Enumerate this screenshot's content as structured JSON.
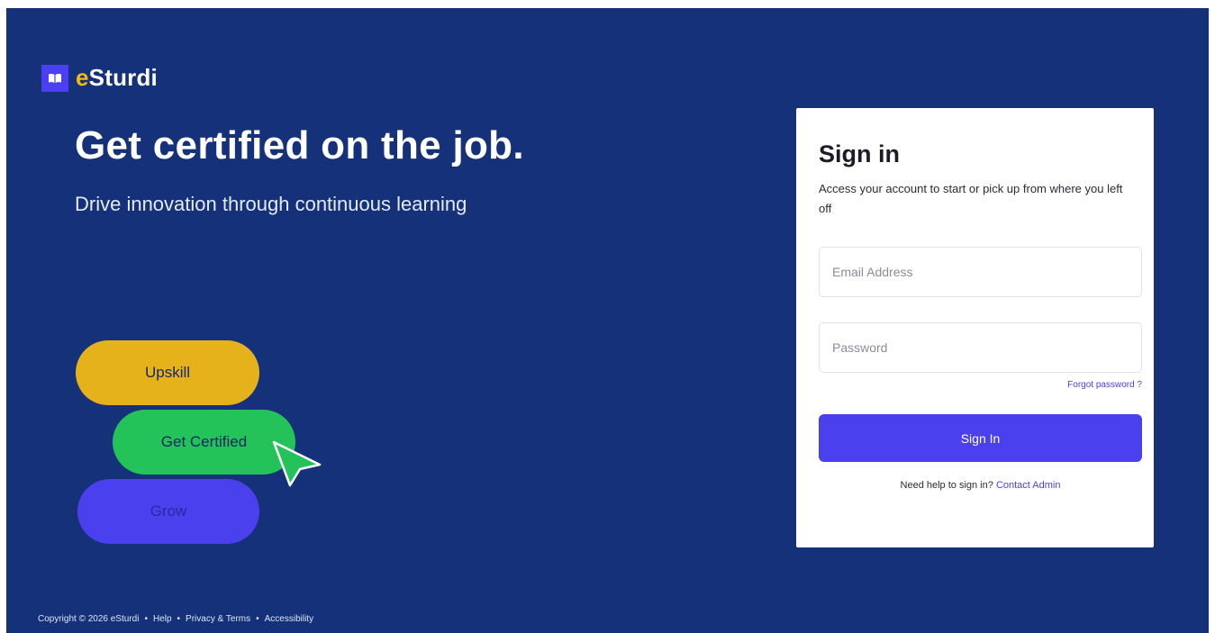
{
  "brand": {
    "name_e": "e",
    "name_rest": "Sturdi",
    "logo_icon": "open-book-icon",
    "colors": {
      "background": "#14317a",
      "accent": "#4b40ee",
      "yellow": "#e6b21c",
      "green": "#23c35a"
    }
  },
  "hero": {
    "title": "Get certified on the job.",
    "subtitle": "Drive innovation through continuous learning"
  },
  "pills": {
    "upskill": "Upskill",
    "certified": "Get Certified",
    "grow": "Grow"
  },
  "signin": {
    "title": "Sign in",
    "description": "Access your account to start or pick up from where you left off",
    "email_placeholder": "Email Address",
    "password_placeholder": "Password",
    "forgot_label": "Forgot password ?",
    "button_label": "Sign In",
    "help_text": "Need help to sign in?",
    "help_link": "Contact Admin"
  },
  "footer": {
    "copyright": "Copyright © 2026 eSturdi",
    "sep": "•",
    "help": "Help",
    "privacy": "Privacy & Terms",
    "accessibility": "Accessibility"
  }
}
